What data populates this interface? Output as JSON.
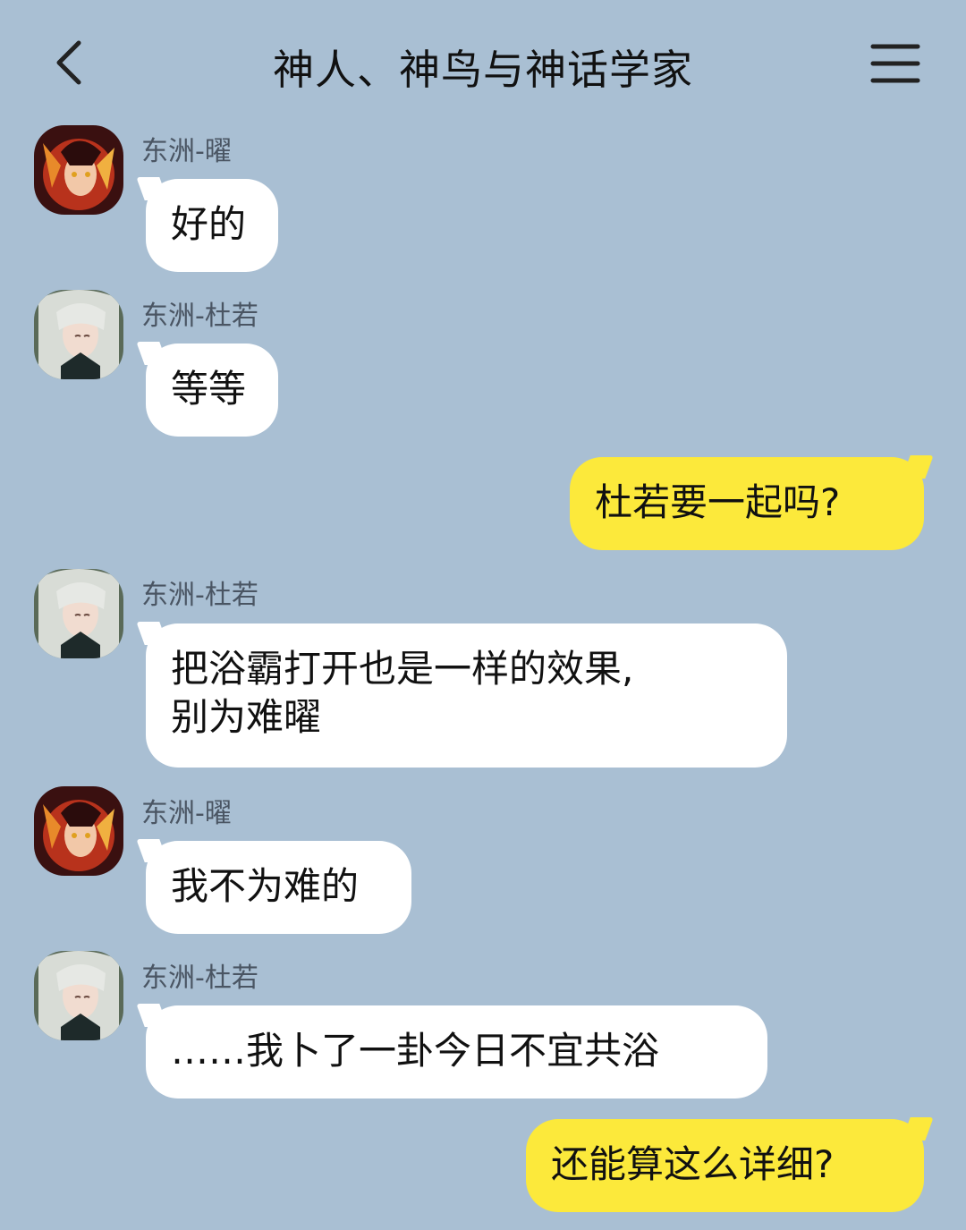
{
  "header": {
    "title": "神人、神鸟与神话学家",
    "back_icon": "chevron-left-icon",
    "menu_icon": "menu-icon"
  },
  "colors": {
    "background": "#a9bfd3",
    "bubble_received": "#ffffff",
    "bubble_sent": "#fce93b"
  },
  "messages": [
    {
      "sender": "东洲-曜",
      "text": "好的",
      "direction": "received",
      "avatar": "avatar-yao"
    },
    {
      "sender": "东洲-杜若",
      "text": "等等",
      "direction": "received",
      "avatar": "avatar-duruo"
    },
    {
      "text": "杜若要一起吗?",
      "direction": "sent"
    },
    {
      "sender": "东洲-杜若",
      "text": "把浴霸打开也是一样的效果,\n别为难曜",
      "direction": "received",
      "avatar": "avatar-duruo"
    },
    {
      "sender": "东洲-曜",
      "text": "我不为难的",
      "direction": "received",
      "avatar": "avatar-yao"
    },
    {
      "sender": "东洲-杜若",
      "text": "……我卜了一卦今日不宜共浴",
      "direction": "received",
      "avatar": "avatar-duruo"
    },
    {
      "text": "还能算这么详细?",
      "direction": "sent"
    }
  ]
}
